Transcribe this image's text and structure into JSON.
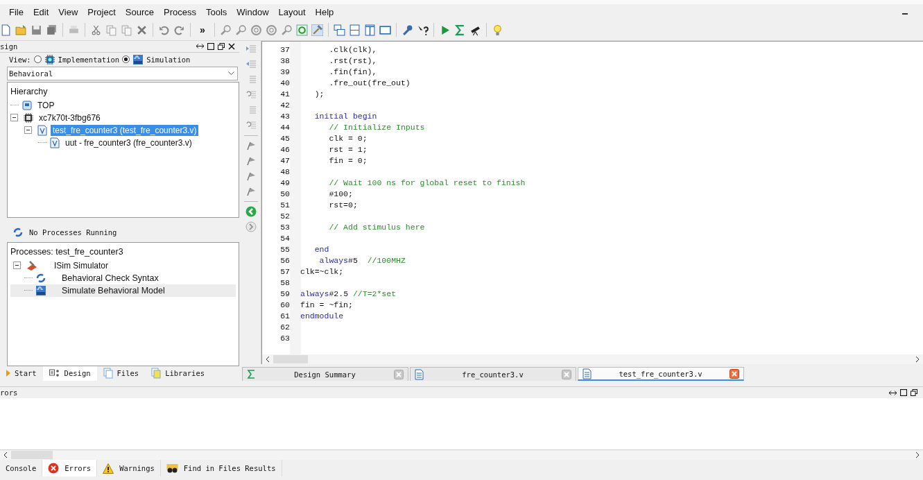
{
  "menu": [
    "File",
    "Edit",
    "View",
    "Project",
    "Source",
    "Process",
    "Tools",
    "Window",
    "Layout",
    "Help"
  ],
  "toolbar": {
    "overflow": "»"
  },
  "design_panel": {
    "title": "sign",
    "view_label": "View:",
    "view_options": [
      {
        "label": "Implementation",
        "selected": false
      },
      {
        "label": "Simulation",
        "selected": true
      }
    ],
    "dropdown": {
      "value": "Behavioral"
    },
    "hierarchy": {
      "title": "Hierarchy",
      "items": [
        {
          "kind": "top",
          "label": "TOP",
          "selected": false
        },
        {
          "kind": "chip",
          "label": "xc7k70t-3fbg676",
          "selected": false,
          "expanded": true,
          "children": [
            {
              "kind": "verilog",
              "label": "test_fre_counter3 (test_fre_counter3.v)",
              "selected": true,
              "expanded": true,
              "children": [
                {
                  "kind": "verilog",
                  "label": "uut - fre_counter3 (fre_counter3.v)",
                  "selected": false
                }
              ]
            }
          ]
        }
      ]
    },
    "status": "No Processes Running",
    "processes": {
      "title": "Processes: test_fre_counter3",
      "tool": {
        "label": "ISim Simulator",
        "expanded": true
      },
      "items": [
        {
          "kind": "refresh",
          "label": "Behavioral Check Syntax",
          "hovered": false
        },
        {
          "kind": "isim",
          "label": "Simulate Behavioral Model",
          "hovered": true
        }
      ]
    },
    "tabs": [
      {
        "label": "Start",
        "selected": false
      },
      {
        "label": "Design",
        "selected": true
      },
      {
        "label": "Files",
        "selected": false
      },
      {
        "label": "Libraries",
        "selected": false
      }
    ]
  },
  "editor": {
    "lines": [
      {
        "number": "37",
        "segments": [
          {
            "kind": "plain",
            "text": "      .clk(clk),"
          }
        ]
      },
      {
        "number": "38",
        "segments": [
          {
            "kind": "plain",
            "text": "      .rst(rst),"
          }
        ]
      },
      {
        "number": "39",
        "segments": [
          {
            "kind": "plain",
            "text": "      .fin(fin),"
          }
        ]
      },
      {
        "number": "40",
        "segments": [
          {
            "kind": "plain",
            "text": "      .fre_out(fre_out)"
          }
        ]
      },
      {
        "number": "41",
        "segments": [
          {
            "kind": "plain",
            "text": "   );"
          }
        ]
      },
      {
        "number": "42"
      },
      {
        "number": "43",
        "segments": [
          {
            "kind": "keyword",
            "text": "   initial begin"
          }
        ]
      },
      {
        "number": "44",
        "segments": [
          {
            "kind": "comment",
            "text": "      // Initialize Inputs"
          }
        ]
      },
      {
        "number": "45",
        "segments": [
          {
            "kind": "plain",
            "text": "      clk = 0;"
          }
        ]
      },
      {
        "number": "46",
        "segments": [
          {
            "kind": "plain",
            "text": "      rst = 1;"
          }
        ]
      },
      {
        "number": "47",
        "segments": [
          {
            "kind": "plain",
            "text": "      fin = 0;"
          }
        ]
      },
      {
        "number": "48"
      },
      {
        "number": "49",
        "segments": [
          {
            "kind": "comment",
            "text": "      // Wait 100 ns for global reset to finish"
          }
        ]
      },
      {
        "number": "50",
        "segments": [
          {
            "kind": "plain",
            "text": "      #100;"
          }
        ]
      },
      {
        "number": "51",
        "segments": [
          {
            "kind": "plain",
            "text": "      rst=0;"
          }
        ]
      },
      {
        "number": "52"
      },
      {
        "number": "53",
        "segments": [
          {
            "kind": "comment",
            "text": "      // Add stimulus here"
          }
        ]
      },
      {
        "number": "54"
      },
      {
        "number": "55",
        "segments": [
          {
            "kind": "keyword",
            "text": "   end"
          }
        ]
      },
      {
        "number": "56",
        "segments": [
          {
            "kind": "keyword",
            "text": "    always"
          },
          {
            "kind": "plain",
            "text": "#5  "
          },
          {
            "kind": "comment",
            "text": "//100MHZ"
          }
        ]
      },
      {
        "number": "57",
        "segments": [
          {
            "kind": "plain",
            "text": "clk=~clk;"
          }
        ]
      },
      {
        "number": "58"
      },
      {
        "number": "59",
        "segments": [
          {
            "kind": "keyword",
            "text": "always"
          },
          {
            "kind": "plain",
            "text": "#2.5 "
          },
          {
            "kind": "comment",
            "text": "//T=2*set"
          }
        ]
      },
      {
        "number": "60",
        "segments": [
          {
            "kind": "plain",
            "text": "fin = ~fin;"
          }
        ]
      },
      {
        "number": "61",
        "segments": [
          {
            "kind": "keyword",
            "text": "endmodule"
          }
        ]
      },
      {
        "number": "62"
      },
      {
        "number": "63"
      }
    ],
    "tabs": [
      {
        "kind": "summary",
        "label": "Design Summary",
        "selected": false
      },
      {
        "kind": "file",
        "label": "fre_counter3.v",
        "selected": false
      },
      {
        "kind": "file",
        "label": "test_fre_counter3.v",
        "selected": true
      }
    ]
  },
  "errors_panel": {
    "title": "rors",
    "tabs": [
      {
        "kind": "console",
        "label": "Console",
        "selected": false
      },
      {
        "kind": "error",
        "label": "Errors",
        "selected": true
      },
      {
        "kind": "warning",
        "label": "Warnings",
        "selected": false
      },
      {
        "kind": "find",
        "label": "Find in Files Results",
        "selected": false
      }
    ]
  }
}
